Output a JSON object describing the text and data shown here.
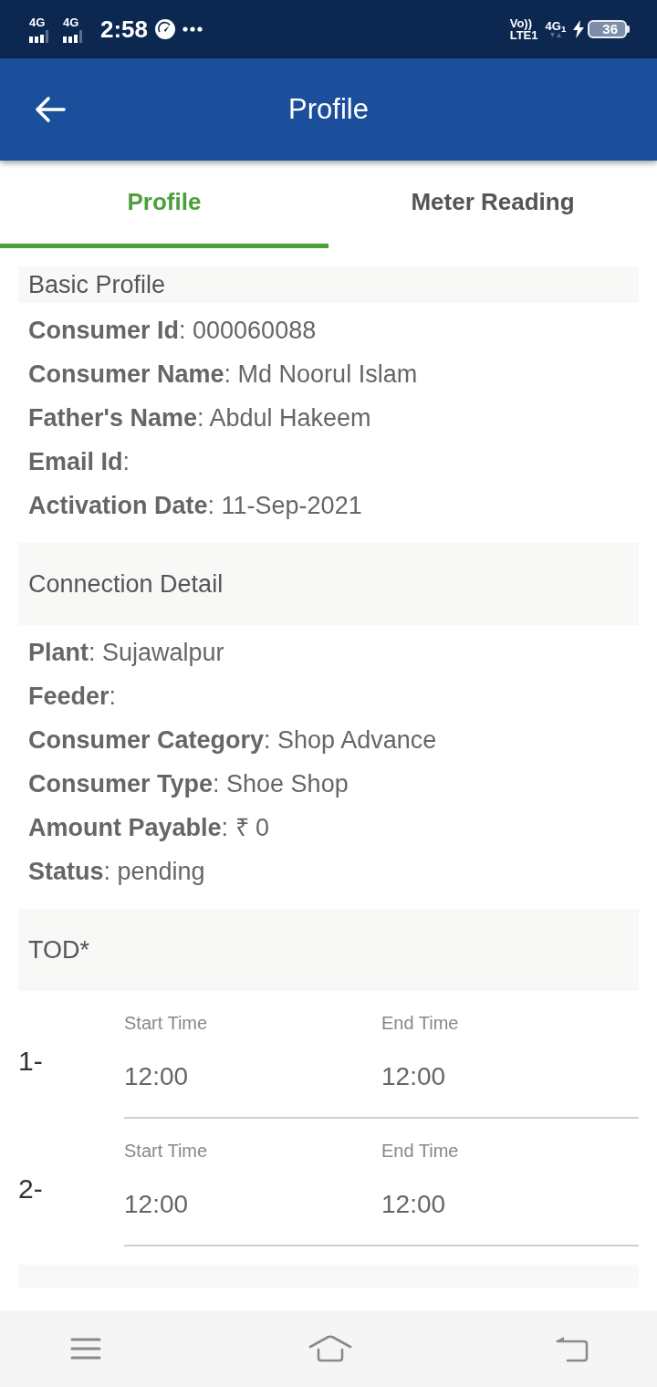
{
  "status_bar": {
    "sim_1_network": "4G",
    "sim_2_network": "4G",
    "time": "2:58",
    "volte_top": "Vo))",
    "volte_bottom": "LTE1",
    "data_network": "4G$_{1}$",
    "battery": "36"
  },
  "app_bar": {
    "title": "Profile"
  },
  "tabs": [
    {
      "label": "Profile",
      "selected": true
    },
    {
      "label": "Meter Reading",
      "selected": false
    }
  ],
  "sections": [
    {
      "kind": "details",
      "title": "Basic Profile",
      "lines": [
        "**Consumer Id**: 000060088",
        "**Consumer Name**: Md Noorul Islam",
        "**Father's Name**: Abdul Hakeem",
        "**Email Id**:",
        "**Activation Date**: 11-Sep-2021"
      ]
    },
    {
      "kind": "details",
      "title": "Connection Detail",
      "lines": [
        "**Plant**: Sujawalpur",
        "**Feeder**:",
        "**Consumer Category**: Shop Advance",
        "**Consumer Type**: Shoe Shop",
        "**Amount Payable**: ₹ 0",
        "**Status**: pending"
      ]
    },
    {
      "kind": "time_slots",
      "title": "TOD*",
      "slots": [
        {
          "number": "1-",
          "start_label": "Start Time",
          "start": "12:00",
          "end_label": "End Time",
          "end": "12:00"
        },
        {
          "number": "2-",
          "start_label": "Start Time",
          "start": "12:00",
          "end_label": "End Time",
          "end": "12:00"
        }
      ]
    },
    {
      "kind": "header_only"
    }
  ]
}
